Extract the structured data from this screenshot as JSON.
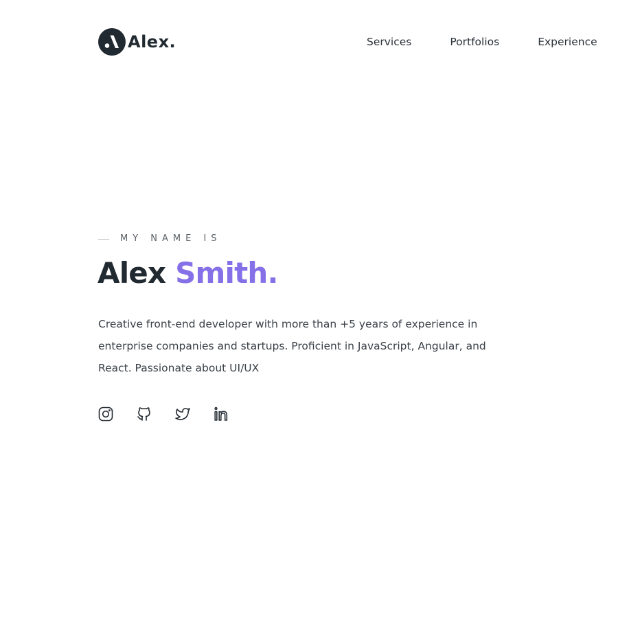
{
  "header": {
    "logo_text": "Alex.",
    "logo_icon": "logo-mark-icon",
    "nav": [
      {
        "label": "Services"
      },
      {
        "label": "Portfolios"
      },
      {
        "label": "Experience"
      }
    ]
  },
  "hero": {
    "eyebrow": "MY NAME IS",
    "first_name": "Alex",
    "last_name": "Smith.",
    "description": "Creative front-end developer with more than +5 years of experience in enterprise companies and startups. Proficient in JavaScript, Angular, and React. Passionate about UI/UX",
    "socials": [
      {
        "icon": "instagram-icon"
      },
      {
        "icon": "github-icon"
      },
      {
        "icon": "twitter-icon"
      },
      {
        "icon": "linkedin-icon"
      }
    ]
  },
  "colors": {
    "text_dark": "#222a31",
    "accent": "#8670e8",
    "body_text": "#3b4148",
    "muted": "#5c6166"
  }
}
